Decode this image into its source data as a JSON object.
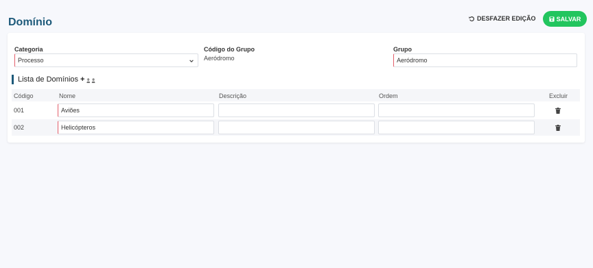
{
  "header": {
    "title": "Domínio",
    "undo_label": "DESFAZER EDIÇÃO",
    "save_label": "SALVAR"
  },
  "form": {
    "categoria": {
      "label": "Categoria",
      "value": "Processo"
    },
    "codigo_grupo": {
      "label": "Código do Grupo",
      "value": "Aeródromo"
    },
    "grupo": {
      "label": "Grupo",
      "value": "Aeródromo"
    }
  },
  "list": {
    "title": "Lista de Domínios",
    "add_symbol": "+",
    "download_symbol": "±",
    "upload_symbol": "±",
    "columns": [
      "Código",
      "Nome",
      "Descrição",
      "Ordem",
      "Excluir"
    ],
    "rows": [
      {
        "codigo": "001",
        "nome": "Aviões",
        "descricao": "",
        "ordem": ""
      },
      {
        "codigo": "002",
        "nome": "Helicópteros",
        "descricao": "",
        "ordem": ""
      }
    ]
  },
  "colors": {
    "title": "#1e5a7a",
    "save_button": "#22c55e",
    "required_border": "#e35d6a"
  }
}
